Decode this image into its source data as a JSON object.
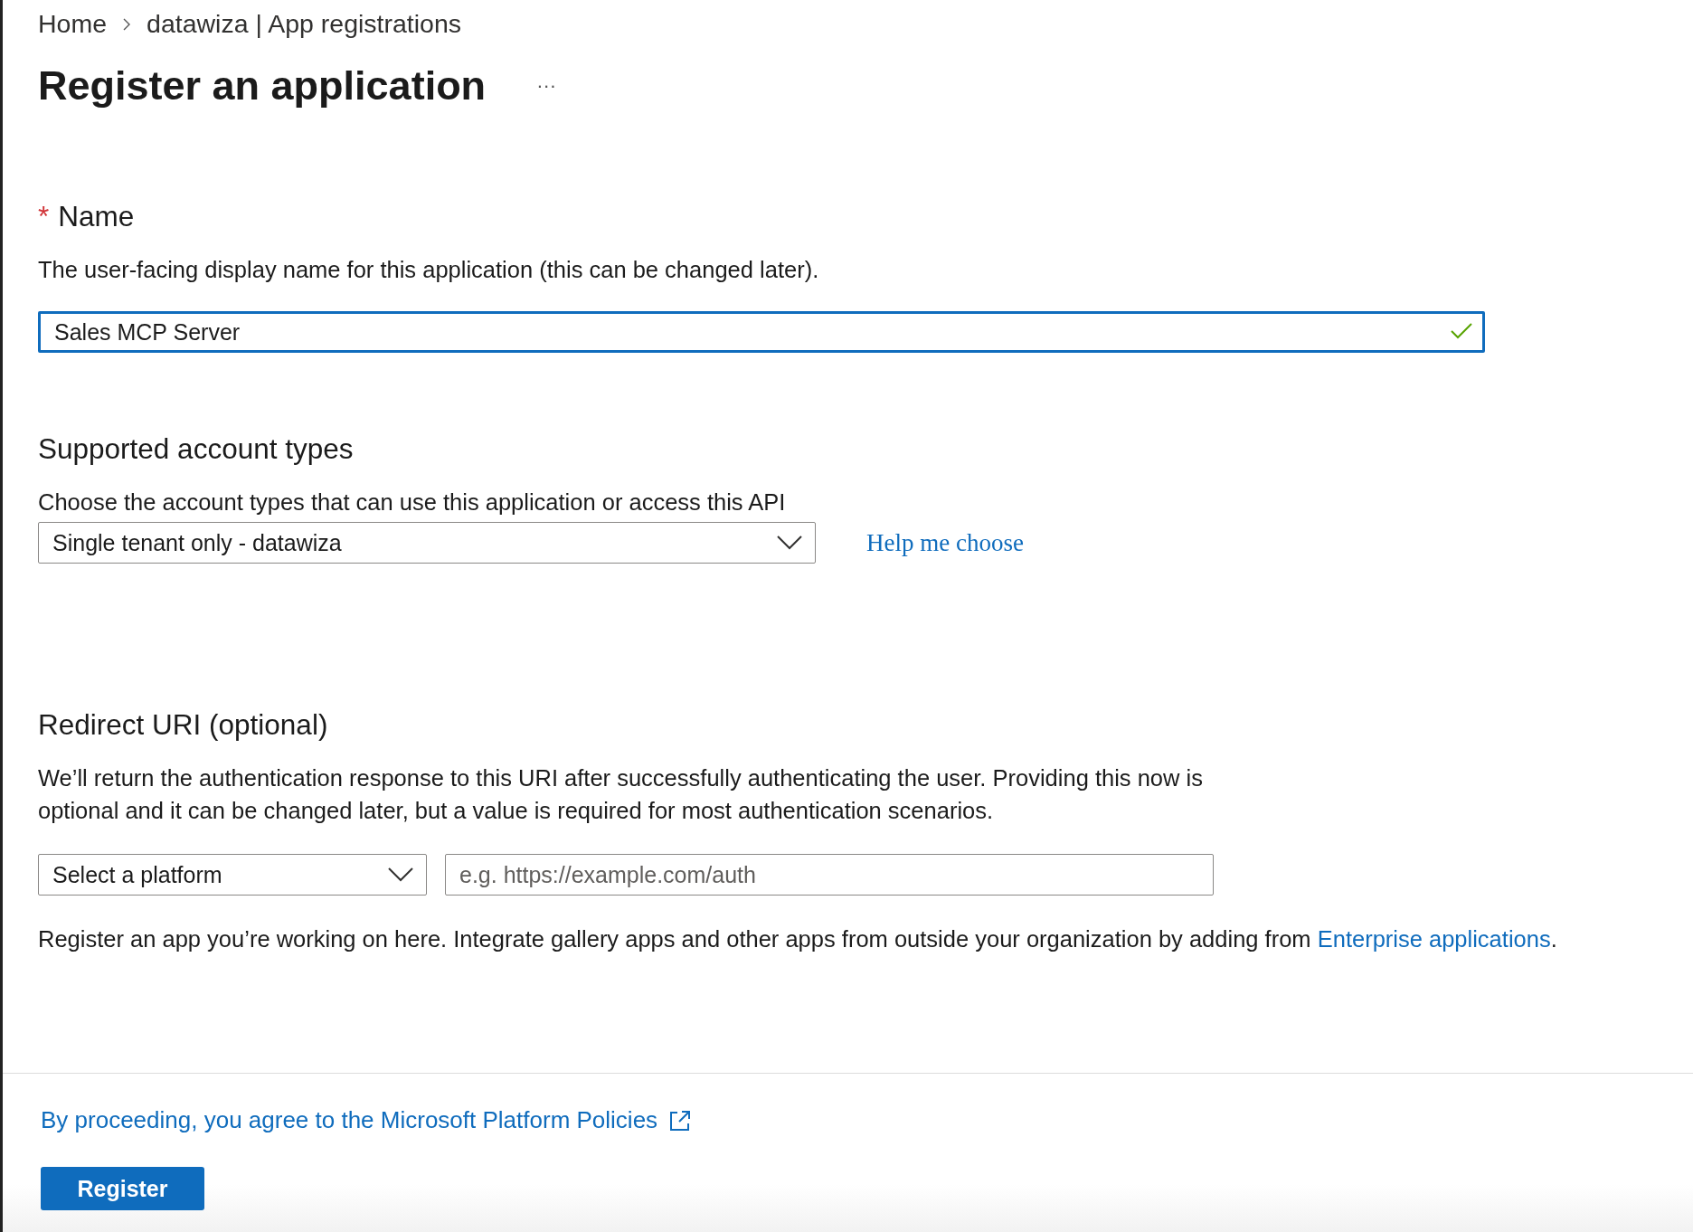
{
  "breadcrumb": [
    {
      "label": "Home"
    },
    {
      "label": "datawiza | App registrations"
    }
  ],
  "page": {
    "title": "Register an application",
    "more": "···"
  },
  "name_section": {
    "required_mark": "*",
    "label": "Name",
    "description": "The user-facing display name for this application (this can be changed later).",
    "value": "Sales MCP Server",
    "valid": true,
    "focused": true
  },
  "account_section": {
    "heading": "Supported account types",
    "description": "Choose the account types that can use this application or access this API",
    "selected": "Single tenant only - datawiza",
    "help_link": "Help me choose"
  },
  "redirect_section": {
    "heading": "Redirect URI (optional)",
    "description": "We’ll return the authentication response to this URI after successfully authenticating the user. Providing this now is optional and it can be changed later, but a value is required for most authentication scenarios.",
    "platform": "Select a platform",
    "uri_placeholder": "e.g. https://example.com/auth"
  },
  "note": {
    "text": "Register an app you’re working on here. Integrate gallery apps and other apps from outside your organization by adding from",
    "link": "Enterprise applications",
    "end": "."
  },
  "footer": {
    "policy_link": "By proceeding, you agree to the Microsoft Platform Policies",
    "button": "Register"
  }
}
